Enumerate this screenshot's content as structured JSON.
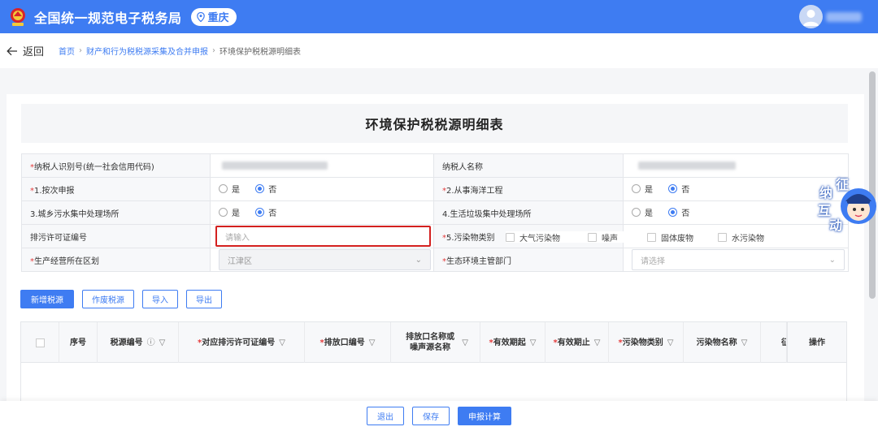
{
  "header": {
    "site_title": "全国统一规范电子税务局",
    "city": "重庆"
  },
  "breadcrumb": {
    "back_label": "返回",
    "items": [
      "首页",
      "财产和行为税税源采集及合并申报",
      "环境保护税税源明细表"
    ]
  },
  "form": {
    "title": "环境保护税税源明细表",
    "taxpayer_id_label": "纳税人识别号(统一社会信用代码)",
    "taxpayer_name_label": "纳税人名称",
    "q1_label": "1.按次申报",
    "q2_label": "2.从事海洋工程",
    "q3_label": "3.城乡污水集中处理场所",
    "q4_label": "4.生活垃圾集中处理场所",
    "yes": "是",
    "no": "否",
    "permit_label": "排污许可证编号",
    "permit_placeholder": "请输入",
    "q5_label": "5.污染物类别",
    "pollutants": [
      "大气污染物",
      "噪声",
      "固体废物",
      "水污染物"
    ],
    "district_label": "生产经营所在区划",
    "district_value": "江津区",
    "eco_dept_label": "生态环境主管部门",
    "eco_dept_placeholder": "请选择"
  },
  "actions": {
    "add": "新增税源",
    "void": "作废税源",
    "import": "导入",
    "export": "导出"
  },
  "table": {
    "columns": [
      {
        "label": "序号",
        "required": false
      },
      {
        "label": "税源编号",
        "required": false
      },
      {
        "label": "对应排污许可证编号",
        "required": true
      },
      {
        "label": "排放口编号",
        "required": true
      },
      {
        "label": "排放口名称或噪声源名称",
        "required": false
      },
      {
        "label": "有效期起",
        "required": true
      },
      {
        "label": "有效期止",
        "required": true
      },
      {
        "label": "污染物类别",
        "required": true
      },
      {
        "label": "污染物名称",
        "required": false
      },
      {
        "label": "征",
        "required": false
      },
      {
        "label": "操作",
        "required": false
      }
    ]
  },
  "footer": {
    "exit": "退出",
    "save": "保存",
    "submit": "申报计算"
  },
  "widget": {
    "chars": [
      "征",
      "纳",
      "互",
      "动"
    ]
  },
  "colors": {
    "primary": "#3e7cf2",
    "error_border": "#d3201f",
    "required": "#e43b3b"
  }
}
